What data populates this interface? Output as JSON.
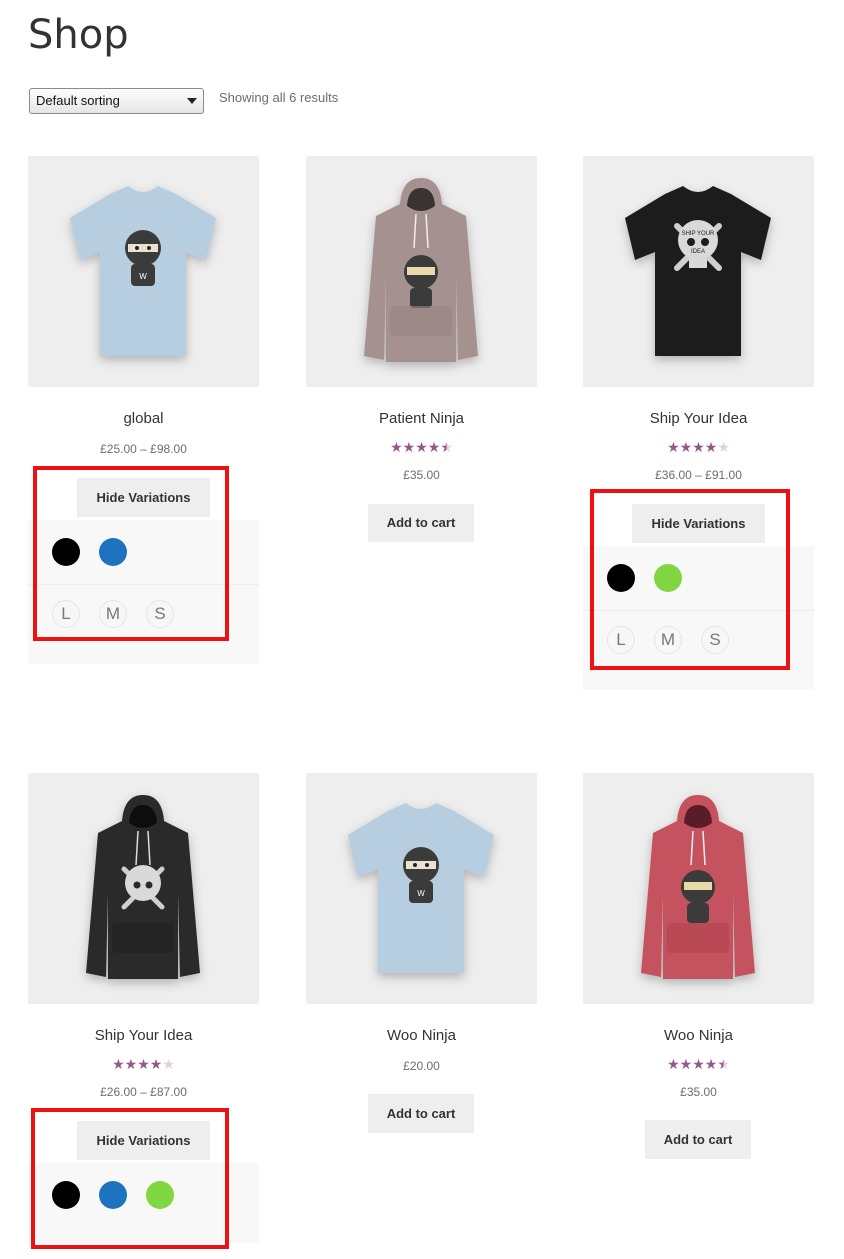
{
  "page": {
    "title": "Shop"
  },
  "toolbar": {
    "sort_value": "Default sorting",
    "result_count": "Showing all 6 results"
  },
  "products": [
    {
      "name": "global",
      "price": "£25.00 – £98.00",
      "rating": null,
      "action": "Hide Variations",
      "product_color": "#b7cde0",
      "colors": [
        "#000000",
        "#1e73be"
      ],
      "sizes": [
        "L",
        "M",
        "S"
      ]
    },
    {
      "name": "Patient Ninja",
      "price": "£35.00",
      "rating": 4.5,
      "rating_text": "★★★★★",
      "action": "Add to cart",
      "product_color": "#a59290"
    },
    {
      "name": "Ship Your Idea",
      "price": "£36.00 – £91.00",
      "rating": 4,
      "rating_text": "★★★★★",
      "action": "Hide Variations",
      "product_color": "#1c1c1c",
      "colors": [
        "#000000",
        "#81d742"
      ],
      "sizes": [
        "L",
        "M",
        "S"
      ]
    },
    {
      "name": "Ship Your Idea",
      "price": "£26.00 – £87.00",
      "rating": 4,
      "rating_text": "★★★★★",
      "action": "Hide Variations",
      "product_color": "#2a2a2a",
      "colors": [
        "#000000",
        "#1e73be",
        "#81d742"
      ]
    },
    {
      "name": "Woo Ninja",
      "price": "£20.00",
      "rating": null,
      "action": "Add to cart",
      "product_color": "#b7cde0"
    },
    {
      "name": "Woo Ninja",
      "price": "£35.00",
      "rating": 4.5,
      "rating_text": "★★★★★",
      "action": "Add to cart",
      "product_color": "#c4525e"
    }
  ],
  "colors": {
    "rating_star": "#96588a",
    "rating_star_empty": "#e6cfe2",
    "highlight_box": "#ee1111"
  }
}
